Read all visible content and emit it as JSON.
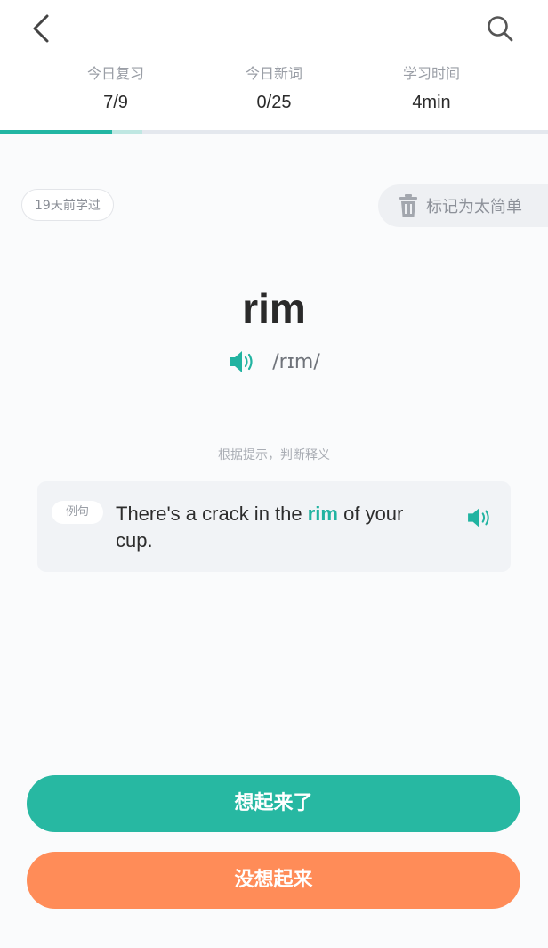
{
  "nav": {
    "back_icon": "chevron-left-icon",
    "search_icon": "search-icon"
  },
  "stats": [
    {
      "label": "今日复习",
      "value": "7/9"
    },
    {
      "label": "今日新词",
      "value": "0/25"
    },
    {
      "label": "学习时间",
      "value": "4min"
    }
  ],
  "progress": {
    "primary_fraction": 0.205,
    "secondary_fraction": 0.26,
    "color": "#22b6a3"
  },
  "badge": {
    "text": "19天前学过"
  },
  "mark_easy": {
    "label": "标记为太简单",
    "icon": "trash-icon"
  },
  "word": {
    "text": "rim",
    "phonetic": "/rɪm/",
    "speaker_icon": "speaker-icon"
  },
  "hint": "根据提示，判断释义",
  "example": {
    "tag": "例句",
    "before": "There's a crack in the ",
    "highlight": "rim",
    "after": " of your cup.",
    "speaker_icon": "speaker-icon"
  },
  "actions": {
    "remembered": "想起来了",
    "forgot": "没想起来"
  },
  "colors": {
    "accent": "#22b6a3",
    "remembered_bg": "#27b8a2",
    "forgot_bg": "#ff8c58"
  }
}
